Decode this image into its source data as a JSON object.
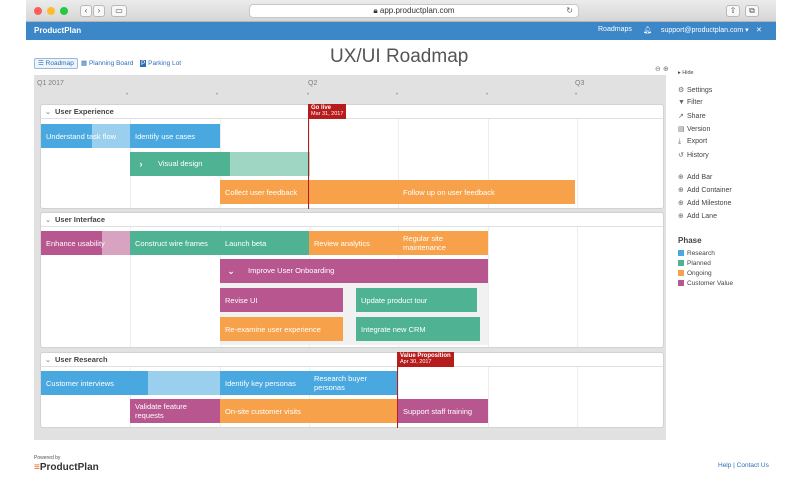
{
  "browser": {
    "url": "app.productplan.com"
  },
  "appbar": {
    "logo": "ProductPlan",
    "roadmaps": "Roadmaps",
    "account": "support@productplan.com ▾",
    "close": "✕"
  },
  "views": [
    {
      "label": "Roadmap",
      "icon": "roadmap-icon"
    },
    {
      "label": "Planning Board",
      "icon": "board-icon"
    },
    {
      "label": "Parking Lot",
      "icon": "parking-icon"
    }
  ],
  "title": "UX/UI Roadmap",
  "timeline": {
    "quarters": [
      "Q1 2017",
      "Q2",
      "Q3"
    ]
  },
  "lanes": [
    {
      "name": "User Experience",
      "bars": [
        {
          "label": "Understand task flow",
          "phase": "Research"
        },
        {
          "label": "Identify use cases",
          "phase": "Research"
        },
        {
          "label": "Visual design",
          "phase": "Planned",
          "container": true
        },
        {
          "label": "Collect user feedback",
          "phase": "Ongoing"
        },
        {
          "label": "Follow up on user feedback",
          "phase": "Ongoing"
        }
      ]
    },
    {
      "name": "User Interface",
      "bars": [
        {
          "label": "Enhance usability",
          "phase": "Customer Value"
        },
        {
          "label": "Construct wire frames",
          "phase": "Planned"
        },
        {
          "label": "Launch beta",
          "phase": "Planned"
        },
        {
          "label": "Review analytics",
          "phase": "Ongoing"
        },
        {
          "label": "Regular site maintenance",
          "phase": "Ongoing"
        },
        {
          "label": "Improve User Onboarding",
          "phase": "Customer Value",
          "container": true
        },
        {
          "label": "Revise UI",
          "phase": "Customer Value"
        },
        {
          "label": "Update product tour",
          "phase": "Planned"
        },
        {
          "label": "Re-examine user experience",
          "phase": "Ongoing"
        },
        {
          "label": "Integrate new CRM",
          "phase": "Planned"
        }
      ]
    },
    {
      "name": "User Research",
      "bars": [
        {
          "label": "Customer interviews",
          "phase": "Research"
        },
        {
          "label": "Identify key personas",
          "phase": "Research"
        },
        {
          "label": "Research buyer personas",
          "phase": "Research"
        },
        {
          "label": "Validate feature requests",
          "phase": "Customer Value"
        },
        {
          "label": "On-site customer visits",
          "phase": "Ongoing"
        },
        {
          "label": "Support staff training",
          "phase": "Customer Value"
        }
      ]
    }
  ],
  "milestones": [
    {
      "label": "Go live",
      "date": "Mar 31, 2017"
    },
    {
      "label": "Value Proposition",
      "date": "Apr 30, 2017"
    }
  ],
  "sidebar": {
    "hide": "Hide",
    "actions": [
      {
        "label": "Settings",
        "icon": "gear-icon"
      },
      {
        "label": "Filter",
        "icon": "filter-icon"
      },
      {
        "label": "Share",
        "icon": "share-icon"
      },
      {
        "label": "Version",
        "icon": "version-icon"
      },
      {
        "label": "Export",
        "icon": "export-icon"
      },
      {
        "label": "History",
        "icon": "history-icon"
      }
    ],
    "add_actions": [
      {
        "label": "Add Bar"
      },
      {
        "label": "Add Container"
      },
      {
        "label": "Add Milestone"
      },
      {
        "label": "Add Lane"
      }
    ],
    "legend_title": "Phase",
    "legend": [
      {
        "label": "Research",
        "color": "#4aa8e0"
      },
      {
        "label": "Planned",
        "color": "#4fb393"
      },
      {
        "label": "Ongoing",
        "color": "#f7a24a"
      },
      {
        "label": "Customer Value",
        "color": "#b8568f"
      }
    ]
  },
  "footer": {
    "powered": "Powered by",
    "logo": "ProductPlan",
    "links": "Help | Contact Us"
  }
}
